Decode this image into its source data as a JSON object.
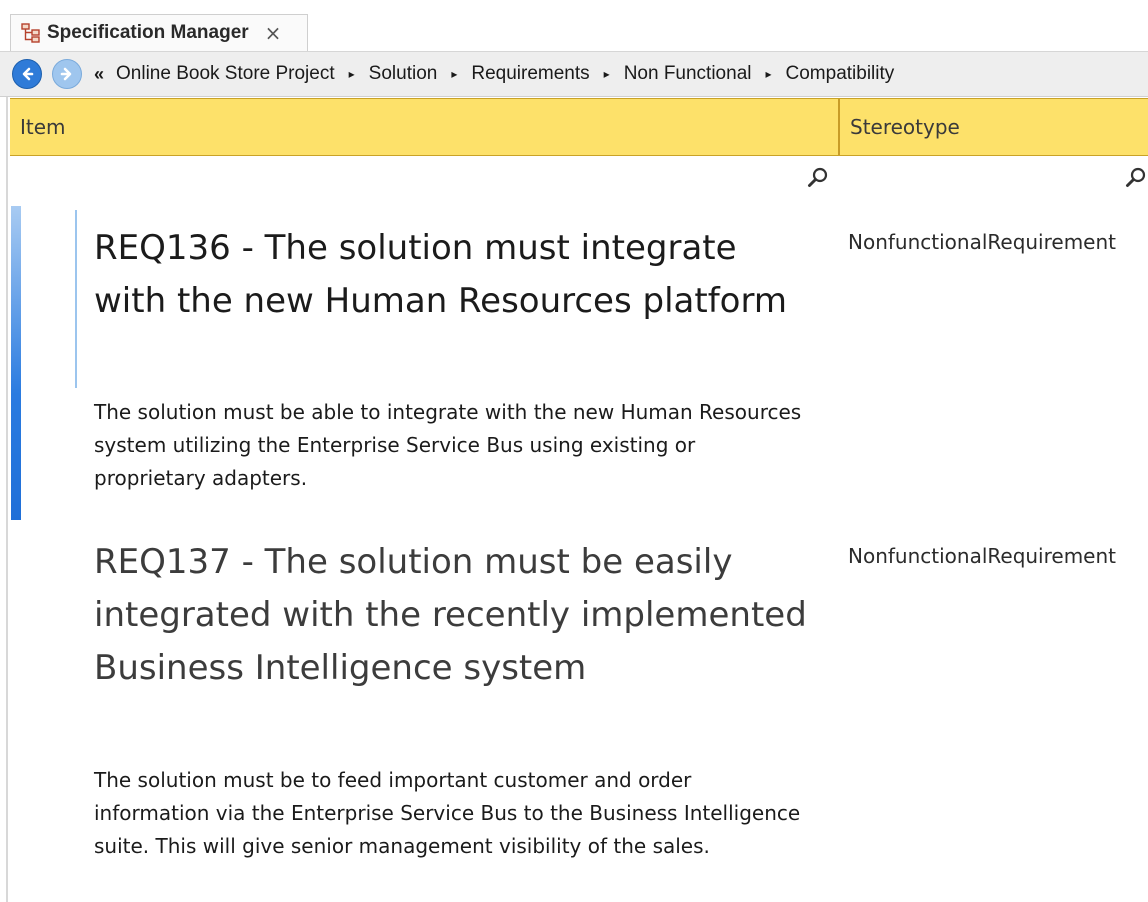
{
  "tab": {
    "title": "Specification Manager",
    "close_glyph": "×",
    "icon": "hierarchy-icon"
  },
  "nav": {
    "back_icon": "back-arrow-icon",
    "forward_icon": "forward-arrow-icon",
    "overflow": "«",
    "separator": "▸",
    "breadcrumbs": [
      "Online Book Store Project",
      "Solution",
      "Requirements",
      "Non Functional",
      "Compatibility"
    ]
  },
  "columns": {
    "item": "Item",
    "stereotype": "Stereotype",
    "filter_icon": "search-icon"
  },
  "requirements": [
    {
      "title": "REQ136 - The solution must integrate with the new Human Resources platform",
      "description": "The solution must be able to integrate with the new Human Resources system utilizing the Enterprise Service Bus using existing or proprietary adapters.",
      "stereotype": "NonfunctionalRequirement"
    },
    {
      "title": "REQ137 - The solution must be easily integrated with the recently implemented Business Intelligence system",
      "description": "The solution must be to feed important customer and order information via the Enterprise Service Bus to the Business Intelligence suite. This will give senior management visibility of the sales.",
      "stereotype": "NonfunctionalRequirement"
    }
  ],
  "colors": {
    "header_bg": "#fde16a",
    "selection_bar": "#2a7be0",
    "nav_back": "#2f7bd8",
    "nav_forward": "#9fc6ee"
  }
}
